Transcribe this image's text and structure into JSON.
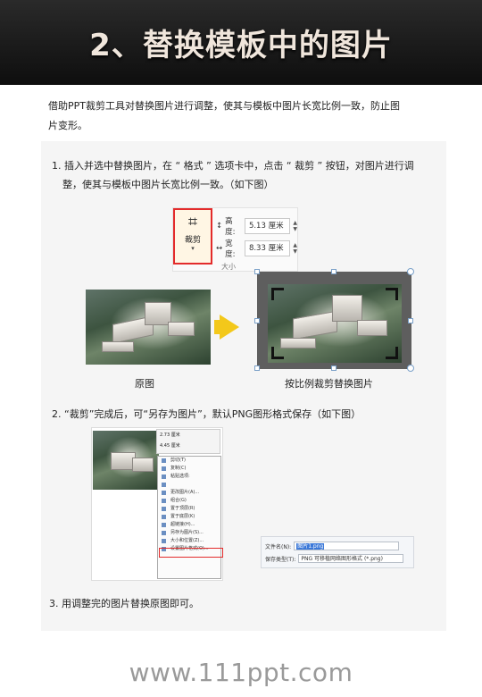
{
  "header": {
    "title": "2、替换模板中的图片"
  },
  "intro": {
    "line1": "借助PPT裁剪工具对替换图片进行调整，使其与模板中图片长宽比例一致，防止图",
    "line2": "片变形。"
  },
  "step1": {
    "line1": "1.   插入并选中替换图片，在  “ 格式 ”  选项卡中，点击  “ 裁剪 ”  按钮，对图片进行调",
    "line2": "整，使其与模板中图片长宽比例一致。（如下图）"
  },
  "ribbon": {
    "crop_label": "裁剪",
    "height_label": "高度:",
    "height_value": "5.13 厘米",
    "width_label": "宽度:",
    "width_value": "8.33 厘米",
    "group_label": "大小"
  },
  "captions": {
    "original": "原图",
    "cropped": "按比例裁剪替换图片"
  },
  "step2": {
    "text": "2. “裁剪”完成后，可“另存为图片”，默认PNG图形格式保存（如下图）"
  },
  "mini_toolbar": {
    "v1": "2.73 厘米",
    "v2": "4.45 厘米"
  },
  "context_menu": {
    "items": [
      "剪切(T)",
      "复制(C)",
      "粘贴选项:",
      "",
      "更改图片(A)...",
      "组合(G)",
      "置于顶层(R)",
      "置于底层(K)",
      "超链接(H)...",
      "另存为图片(S)...",
      "大小和位置(Z)...",
      "设置图片格式(O)..."
    ]
  },
  "save_dialog": {
    "filename_label": "文件名(N):",
    "filename_value": "图片1.png",
    "type_label": "保存类型(T):",
    "type_value": "PNG 可移植网络图形格式 (*.png)"
  },
  "step3": {
    "text": "3. 用调整完的图片替换原图即可。"
  },
  "footer": {
    "url": "www.111ppt.com"
  },
  "colors": {
    "highlight_red": "#e32b2b",
    "arrow_yellow": "#f3c81a",
    "header_bg": "#141414"
  }
}
